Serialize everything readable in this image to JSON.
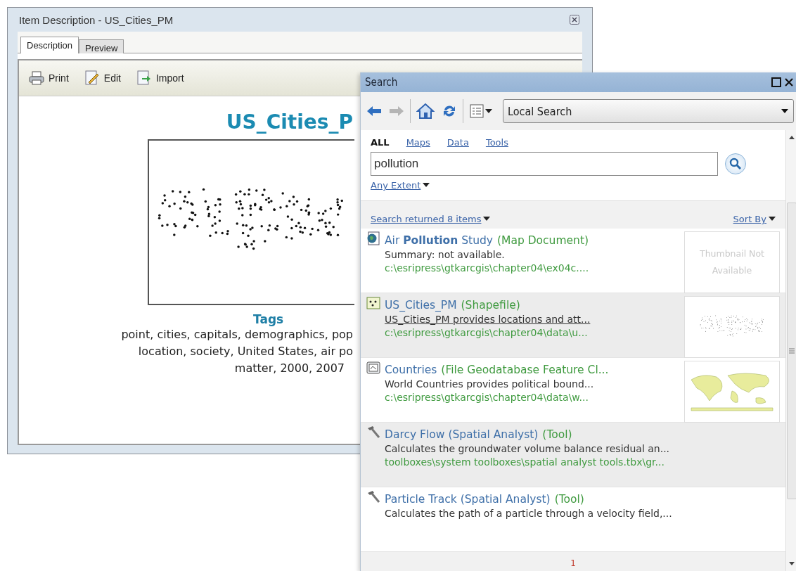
{
  "description_window": {
    "title": "Item Description - US_Cities_PM",
    "tabs": [
      {
        "label": "Description",
        "selected": true
      },
      {
        "label": "Preview",
        "selected": false
      }
    ],
    "toolbar": [
      {
        "kind": "print",
        "label": "Print"
      },
      {
        "kind": "edit",
        "label": "Edit"
      },
      {
        "kind": "import",
        "label": "Import"
      }
    ],
    "heading": "US_Cities_P",
    "tags_heading": "Tags",
    "tags_lines": [
      "point, cities, capitals, demographics, pop",
      "location, society, United States, air po",
      "matter, 2000, 2007"
    ]
  },
  "search_window": {
    "title": "Search",
    "scope": "Local Search",
    "tabs": [
      {
        "label": "ALL",
        "selected": true
      },
      {
        "label": "Maps",
        "selected": false
      },
      {
        "label": "Data",
        "selected": false
      },
      {
        "label": "Tools",
        "selected": false
      }
    ],
    "query": "pollution",
    "extent": "Any Extent",
    "result_count": "Search returned 8 items",
    "sort": "Sort By",
    "results": [
      {
        "kind": "map",
        "title": "Air **Pollution** Study",
        "type": "(Map Document)",
        "summary": "Summary: not available.",
        "path": "c:\\esripress\\gtkarcgis\\chapter04\\ex04c....",
        "hovered": false,
        "thumbnail": {
          "kind": "none",
          "text": "Thumbnail Not Available"
        }
      },
      {
        "kind": "shapefile",
        "title": "US_Cities_PM",
        "type": "(Shapefile)",
        "summary": "US_Cities_PM provides locations and att...",
        "path": "c:\\esripress\\gtkarcgis\\chapter04\\data\\u...",
        "hovered": true,
        "thumbnail": {
          "kind": "points"
        }
      },
      {
        "kind": "feature-class",
        "title": "Countries",
        "type": "(File Geodatabase Feature Cl...",
        "summary": "World Countries provides political bound...",
        "path": "c:\\esripress\\gtkarcgis\\chapter04\\data\\w...",
        "hovered": false,
        "thumbnail": {
          "kind": "world"
        }
      },
      {
        "kind": "tool",
        "title": "Darcy Flow (Spatial Analyst)",
        "type": "(Tool)",
        "summary": "Calculates the groundwater volume balance residual an...",
        "path": "toolboxes\\system toolboxes\\spatial analyst tools.tbx\\gr...",
        "hovered": false
      },
      {
        "kind": "tool",
        "title": "Particle Track (Spatial Analyst)",
        "type": "(Tool)",
        "summary": "Calculates the path of a particle through a velocity field,...",
        "hovered": false
      }
    ],
    "page": "1"
  }
}
